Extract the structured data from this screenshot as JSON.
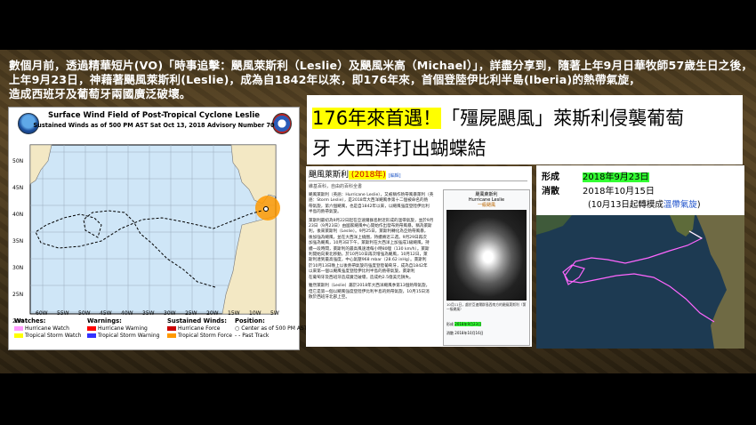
{
  "intro": {
    "line1": "數個月前，透過精華短片(VO)「時事追擊：颶風萊斯利（Leslie）及颶風米高（Michael）」，詳盡分享到，隨著上年9月日華牧師57歲生日之後，",
    "line2": "上年9月23日，神藉著颶風萊斯利(Leslie)，成為自1842年以來，即176年來，首個登陸伊比利半島(Iberia)的熱帶氣旋，",
    "line3": "造成西班牙及葡萄牙兩國廣泛破壞。"
  },
  "map": {
    "title": "Surface Wind Field of Post-Tropical Cyclone Leslie",
    "subtitle": "Sustained Winds as of 500 PM AST Sat Oct 13, 2018     Advisory Number 70",
    "lat_labels": [
      "50N",
      "45N",
      "40N",
      "35N",
      "30N",
      "25N",
      "20N"
    ],
    "lon_labels": [
      "60W",
      "55W",
      "50W",
      "45W",
      "40W",
      "35W",
      "30W",
      "25W",
      "20W",
      "15W",
      "10W",
      "5W"
    ],
    "legend": {
      "watches_head": "Watches:",
      "watches": [
        "Hurricane Watch",
        "Tropical Storm Watch"
      ],
      "warnings_head": "Warnings:",
      "warnings": [
        "Hurricane Warning",
        "Tropical Storm Warning"
      ],
      "winds_head": "Sustained Winds:",
      "winds": [
        "Hurricane Force",
        "Tropical Storm Force"
      ],
      "position_head": "Position:",
      "position": [
        "Center as of 500 PM AST",
        "Past Track"
      ]
    },
    "colors": {
      "hurricane_watch": "#ff99ff",
      "ts_watch": "#ffff00",
      "hurricane_warning": "#ff0000",
      "ts_warning": "#3333ff",
      "hurricane_force": "#cc0000",
      "ts_force": "#ff9900"
    }
  },
  "headline": {
    "line1_pre": "176年來首遇！",
    "line1_post": "「殭屍颶風」萊斯利侵襲葡萄",
    "line2": "牙   大西洋打出蝴蝶結"
  },
  "wiki": {
    "title_pre": "颶風萊斯利",
    "title_mark": " (2018年)",
    "edit": "[編輯]",
    "from": "維基百科，自由的百科全書",
    "body": [
      "颶風萊斯利（英語：Hurricane Leslie），又被稱作熱帶風暴萊利（英",
      "語：Storm Leslie），是2018年大西洋颶風季第十二個被命名的熱",
      "帶氣旋，第六個颶風，也是自1842年以來，以颶風強度登陸伊比利",
      "半島的熱帶氣旋。",
      "",
      "萊斯利最初為9月22日起在亞速爾群島附近形成的溫帶氣旋，並於9月",
      "23日（9月23日）由國家颶風中心開始作出發布熱帶風暴，稱為萊斯",
      "利，後來萊斯利（Leslie）。9月25日，萊斯利轉化為亞熱帶風暴，",
      "後加強為颶風，並在大西洋上繞圈，持續將近三週。9月29日再次",
      "加強為颶風，10月3日下午，萊斯利在大西洋上加強成1級颶風，持",
      "續一段時間，萊斯利的最高風速達每小時80哩（130 km/h）。萊斯",
      "利開始向東北移動，於10月10日再次增強為颶風，10月12日，萊",
      "斯利達到最高強度，中心氣壓968 mbar（28.62 inHg）。萊斯利",
      "於10月13日晚上以後熱帶氣旋的強度登陸葡萄牙，成為自1842年",
      "以來第一個以颶風強度登陸伊比利半島的熱帶氣旋。萊斯利",
      "在葡萄牙及西班牙造成廣泛破壞，造成約2.5億美元損失。",
      "",
      "雖然萊斯利（Leslie）屬於2018年大西洋颶風季第13個熱帶氣旋，",
      "但它是第一個以颶風強度登陸伊比利半島的熱帶氣旋，10月15日消",
      "散於西班牙北部上空。"
    ],
    "infobox": {
      "head1": "颶風萊斯利",
      "head2": "Hurricane Leslie",
      "head3": "一級颶風",
      "caption": "10月11日，處於亞速爾群島西南方的颶風萊斯利（第一級颶風）",
      "formed_label": "形成",
      "formed": "2018年9月23日",
      "dissipated_label": "消散",
      "dissipated": "2018年10月16日"
    }
  },
  "track": {
    "formed_label": "形成",
    "formed": "2018年9月23日",
    "dissipated_label": "消散",
    "dissipated": "2018年10月15日",
    "note_pre": "(10月13日起轉模成",
    "note_link": "溫帶氣旋",
    "note_post": ")"
  }
}
